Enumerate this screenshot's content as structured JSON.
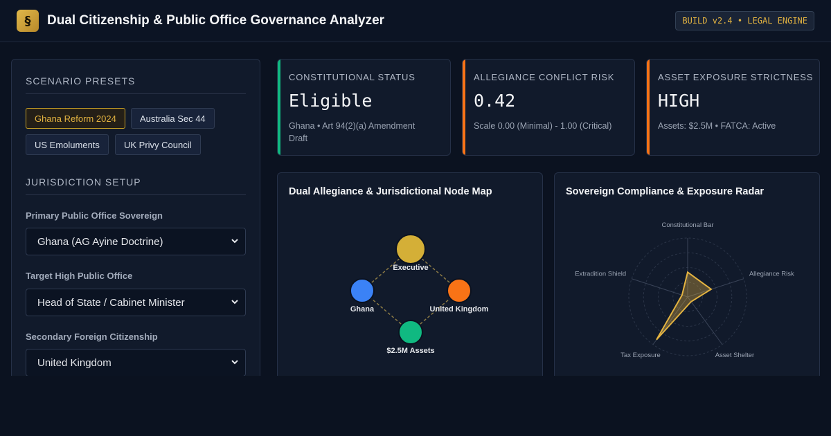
{
  "header": {
    "logo_glyph": "§",
    "title": "Dual Citizenship & Public Office Governance Analyzer",
    "build_badge": "BUILD v2.4 • LEGAL ENGINE"
  },
  "sidebar": {
    "presets_title": "SCENARIO PRESETS",
    "presets": [
      {
        "label": "Ghana Reform 2024",
        "active": true
      },
      {
        "label": "Australia Sec 44",
        "active": false
      },
      {
        "label": "US Emoluments",
        "active": false
      },
      {
        "label": "UK Privy Council",
        "active": false
      }
    ],
    "setup_title": "JURISDICTION SETUP",
    "fields": [
      {
        "label": "Primary Public Office Sovereign",
        "value": "Ghana (AG Ayine Doctrine)"
      },
      {
        "label": "Target High Public Office",
        "value": "Head of State / Cabinet Minister"
      },
      {
        "label": "Secondary Foreign Citizenship",
        "value": "United Kingdom"
      }
    ]
  },
  "cards": [
    {
      "label": "CONSTITUTIONAL STATUS",
      "value": "Eligible",
      "sub": "Ghana • Art 94(2)(a) Amendment Draft",
      "accent": "#10b981"
    },
    {
      "label": "ALLEGIANCE CONFLICT RISK",
      "value": "0.42",
      "sub": "Scale 0.00 (Minimal) - 1.00 (Critical)",
      "accent": "#f97316"
    },
    {
      "label": "ASSET EXPOSURE STRICTNESS",
      "value": "HIGH",
      "sub": "Assets: $2.5M • FATCA: Active",
      "accent": "#f97316"
    }
  ],
  "node_map": {
    "title": "Dual Allegiance & Jurisdictional Node Map",
    "nodes": [
      {
        "id": "executive",
        "label": "Executive",
        "color": "#d4af37"
      },
      {
        "id": "ghana",
        "label": "Ghana",
        "color": "#3b82f6"
      },
      {
        "id": "uk",
        "label": "United Kingdom",
        "color": "#f97316"
      },
      {
        "id": "assets",
        "label": "$2.5M Assets",
        "color": "#10b981"
      }
    ],
    "edges": [
      [
        "executive",
        "ghana"
      ],
      [
        "executive",
        "uk"
      ],
      [
        "ghana",
        "assets"
      ],
      [
        "uk",
        "assets"
      ]
    ]
  },
  "radar": {
    "title": "Sovereign Compliance & Exposure Radar",
    "axes": [
      "Constitutional Bar",
      "Allegiance Risk",
      "Asset Shelter",
      "Tax Exposure",
      "Extradition Shield"
    ],
    "values": [
      0.42,
      0.42,
      0.1,
      0.9,
      0.1
    ],
    "color": "#e3b341"
  }
}
